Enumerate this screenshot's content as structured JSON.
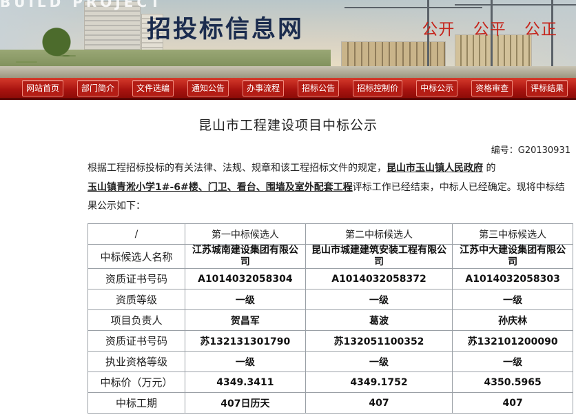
{
  "banner": {
    "build_text": "BUILD PROJECT",
    "site_title": "招投标信息网",
    "slogans": [
      "公开",
      "公平",
      "公正"
    ]
  },
  "nav": {
    "items": [
      "网站首页",
      "部门简介",
      "文件选编",
      "通知公告",
      "办事流程",
      "招标公告",
      "招标控制价",
      "中标公示",
      "资格审查",
      "评标结果"
    ]
  },
  "page": {
    "heading": "昆山市工程建设项目中标公示",
    "doc_no": "编号：G20130931",
    "intro_pre": "根据工程招标投标的有关法律、法规、规章和该工程招标文件的规定，",
    "tenderer": "昆山市玉山镇人民政府",
    "intro_mid": " 的",
    "project": "玉山镇青淞小学1#-6#楼、门卫、看台、围墙及室外配套工程",
    "intro_post": "评标工作已经结束，中标人已经确定。现将中标结果公示如下："
  },
  "table": {
    "corner": "/",
    "headers": [
      "第一中标候选人",
      "第二中标候选人",
      "第三中标候选人"
    ],
    "rows": [
      {
        "label": "中标候选人名称",
        "values": [
          "江苏城南建设集团有限公司",
          "昆山市城建建筑安装工程有限公司",
          "江苏中大建设集团有限公司"
        ]
      },
      {
        "label": "资质证书号码",
        "values": [
          "A1014032058304",
          "A1014032058372",
          "A1014032058303"
        ]
      },
      {
        "label": "资质等级",
        "values": [
          "一级",
          "一级",
          "一级"
        ]
      },
      {
        "label": "项目负责人",
        "values": [
          "贺昌军",
          "葛波",
          "孙庆林"
        ]
      },
      {
        "label": "资质证书号码",
        "values": [
          "苏132131301790",
          "苏132051100352",
          "苏132101200090"
        ]
      },
      {
        "label": "执业资格等级",
        "values": [
          "一级",
          "一级",
          "一级"
        ]
      },
      {
        "label": "中标价（万元）",
        "values": [
          "4349.3411",
          "4349.1752",
          "4350.5965"
        ]
      },
      {
        "label": "中标工期",
        "values": [
          "407日历天",
          "407",
          "407"
        ]
      }
    ]
  },
  "colors": {
    "nav_red": "#a8130f",
    "title_navy": "#1b2c4e",
    "slogan_red": "#c5251c"
  }
}
